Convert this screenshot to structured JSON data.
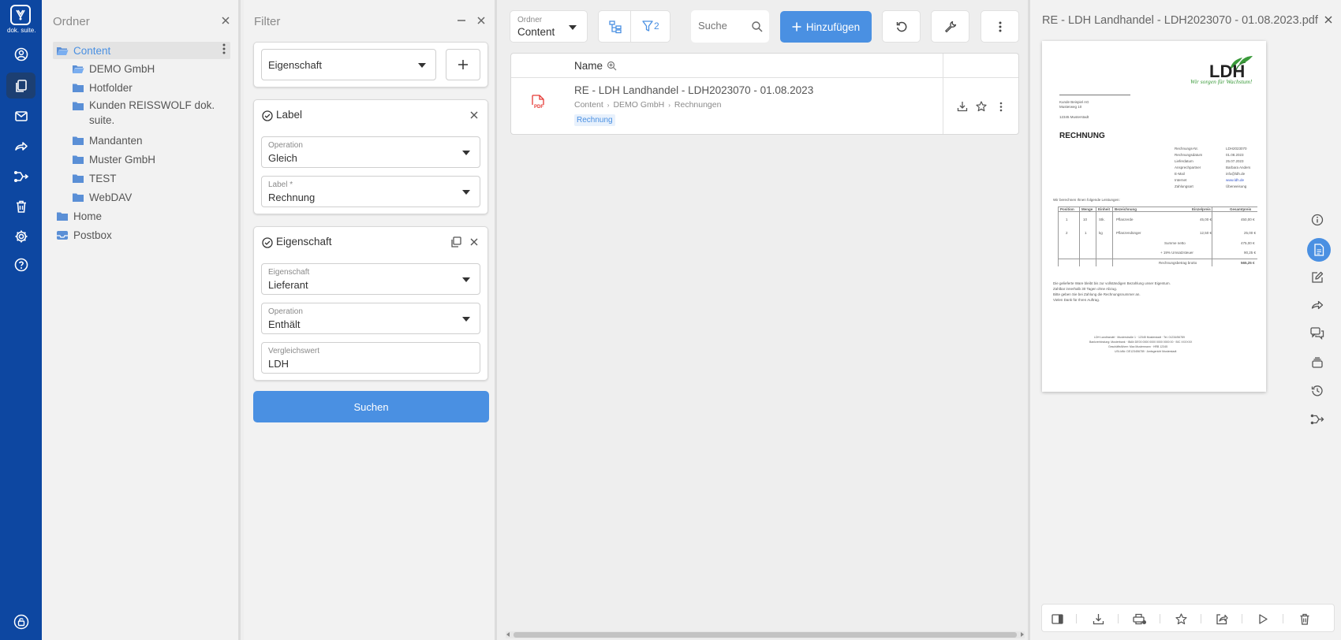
{
  "app": {
    "logo_text": "dok. suite."
  },
  "nav": {
    "items": [
      {
        "name": "account-icon"
      },
      {
        "name": "documents-icon",
        "active": true
      },
      {
        "name": "mail-icon"
      },
      {
        "name": "share-icon"
      },
      {
        "name": "workflow-icon"
      },
      {
        "name": "trash-icon"
      },
      {
        "name": "settings-icon"
      },
      {
        "name": "help-icon"
      }
    ],
    "bottom": "lock-icon"
  },
  "folders": {
    "title": "Ordner",
    "items": [
      {
        "label": "Content",
        "level": 0,
        "selected": true
      },
      {
        "label": "DEMO GmbH",
        "level": 1
      },
      {
        "label": "Hotfolder",
        "level": 1
      },
      {
        "label": "Kunden REISSWOLF dok.",
        "label2": "suite.",
        "level": 1
      },
      {
        "label": "Mandanten",
        "level": 1
      },
      {
        "label": "Muster GmbH",
        "level": 1
      },
      {
        "label": "TEST",
        "level": 1
      },
      {
        "label": "WebDAV",
        "level": 1
      },
      {
        "label": "Home",
        "level": 0
      },
      {
        "label": "Postbox",
        "level": 0
      }
    ]
  },
  "filter": {
    "title": "Filter",
    "property_select": "Eigenschaft",
    "label_card": {
      "title": "Label",
      "operation_label": "Operation",
      "operation_value": "Gleich",
      "label_label": "Label *",
      "label_value": "Rechnung"
    },
    "prop_card": {
      "title": "Eigenschaft",
      "prop_label": "Eigenschaft",
      "prop_value": "Lieferant",
      "operation_label": "Operation",
      "operation_value": "Enthält",
      "compare_label": "Vergleichswert",
      "compare_value": "LDH"
    },
    "search_button": "Suchen"
  },
  "toolbar": {
    "folder_label": "Ordner",
    "folder_value": "Content",
    "filter_count": "2",
    "search_placeholder": "Suche",
    "add_button": "Hinzufügen"
  },
  "results": {
    "column_name": "Name",
    "rows": [
      {
        "title": "RE - LDH Landhandel - LDH2023070 - 01.08.2023",
        "path": [
          "Content",
          "DEMO GmbH",
          "Rechnungen"
        ],
        "tag": "Rechnung",
        "type_badge": "PDF"
      }
    ]
  },
  "preview": {
    "title": "RE - LDH Landhandel - LDH2023070 - 01.08.2023.pdf",
    "doc": {
      "logo": "LDH",
      "slogan": "Wir sorgen für Wachstum!",
      "heading": "RECHNUNG"
    }
  },
  "colors": {
    "nav_bg": "#0d47a1",
    "accent": "#4a90e2",
    "pdf_red": "#e53935",
    "ldh_green": "#3a9a3a"
  }
}
